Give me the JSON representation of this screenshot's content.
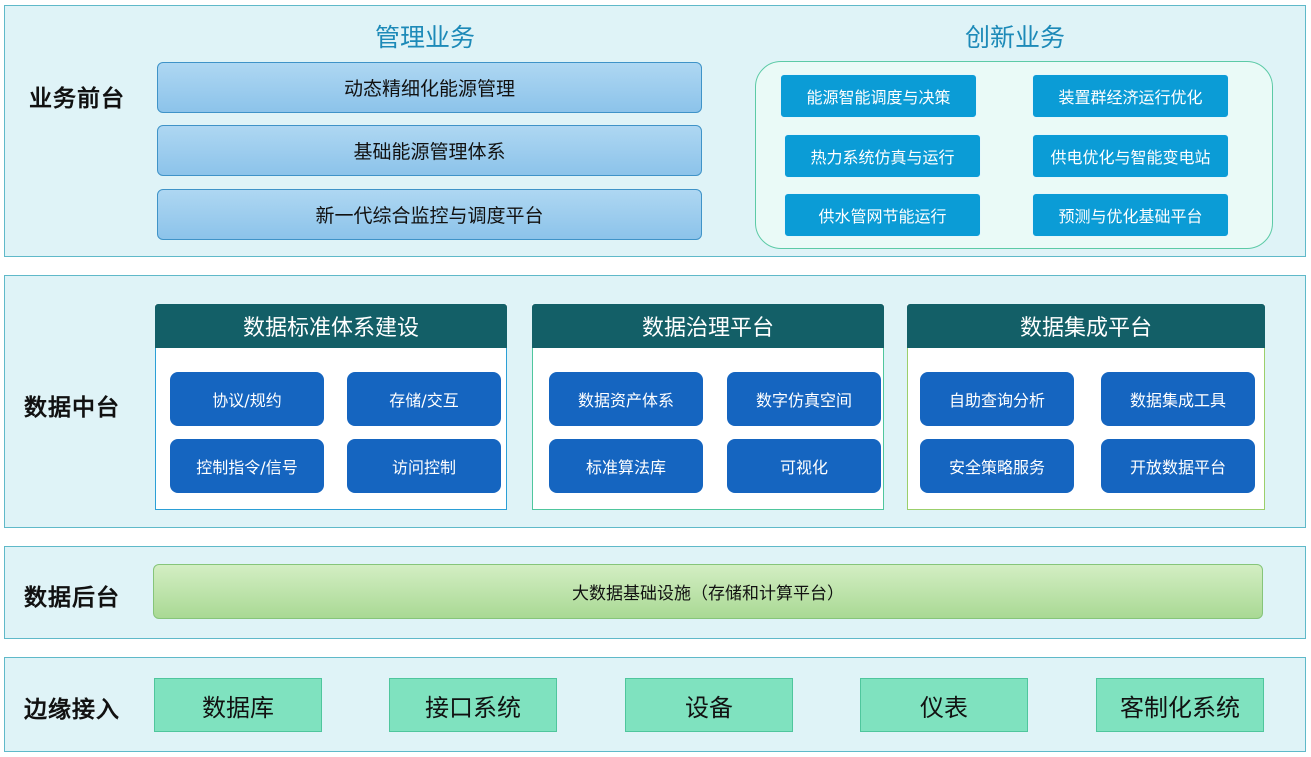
{
  "frontend": {
    "label": "业务前台",
    "management": {
      "title": "管理业务",
      "items": [
        "动态精细化能源管理",
        "基础能源管理体系",
        "新一代综合监控与调度平台"
      ]
    },
    "innovation": {
      "title": "创新业务",
      "items": [
        "能源智能调度与决策",
        "装置群经济运行优化",
        "热力系统仿真与运行",
        "供电优化与智能变电站",
        "供水管网节能运行",
        "预测与优化基础平台"
      ]
    }
  },
  "middle": {
    "label": "数据中台",
    "panels": [
      {
        "title": "数据标准体系建设",
        "items": [
          "协议/规约",
          "存储/交互",
          "控制指令/信号",
          "访问控制"
        ]
      },
      {
        "title": "数据治理平台",
        "items": [
          "数据资产体系",
          "数字仿真空间",
          "标准算法库",
          "可视化"
        ]
      },
      {
        "title": "数据集成平台",
        "items": [
          "自助查询分析",
          "数据集成工具",
          "安全策略服务",
          "开放数据平台"
        ]
      }
    ]
  },
  "backend": {
    "label": "数据后台",
    "infra": "大数据基础设施（存储和计算平台）"
  },
  "edge": {
    "label": "边缘接入",
    "items": [
      "数据库",
      "接口系统",
      "设备",
      "仪表",
      "客制化系统"
    ]
  },
  "colors": {
    "layer_bg": "#dff3f7",
    "layer_border": "#5fb9c9",
    "section_title": "#1d8ab8",
    "panel_head": "#135f67",
    "panel_button": "#1565c0",
    "innovation_button": "#0b9cd6",
    "infra_green": "#a9d994",
    "edge_green": "#7fe2bf"
  }
}
